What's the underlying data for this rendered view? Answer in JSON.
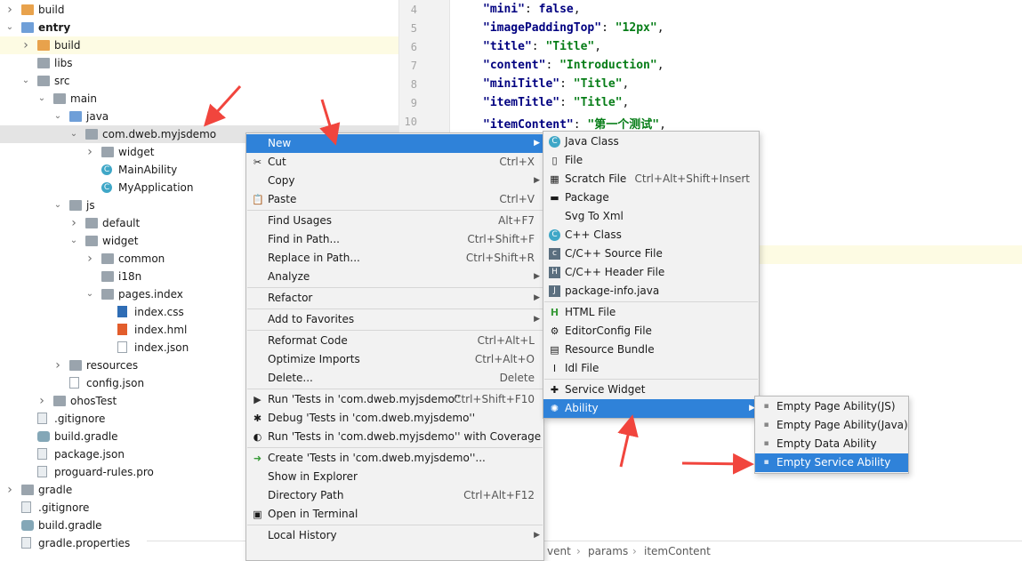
{
  "tree": [
    {
      "label": "build",
      "indent": 0,
      "arrow": ">",
      "icon": "folder-orange"
    },
    {
      "label": "entry",
      "indent": 0,
      "arrow": "v",
      "icon": "folder-blue",
      "bold": true
    },
    {
      "label": "build",
      "indent": 1,
      "arrow": ">",
      "icon": "folder-orange",
      "hl": true
    },
    {
      "label": "libs",
      "indent": 1,
      "arrow": "",
      "icon": "folder"
    },
    {
      "label": "src",
      "indent": 1,
      "arrow": "v",
      "icon": "folder"
    },
    {
      "label": "main",
      "indent": 2,
      "arrow": "v",
      "icon": "folder"
    },
    {
      "label": "java",
      "indent": 3,
      "arrow": "v",
      "icon": "folder-blue"
    },
    {
      "label": "com.dweb.myjsdemo",
      "indent": 4,
      "arrow": "v",
      "icon": "package",
      "selected": true
    },
    {
      "label": "widget",
      "indent": 5,
      "arrow": ">",
      "icon": "package"
    },
    {
      "label": "MainAbility",
      "indent": 5,
      "arrow": "",
      "icon": "class"
    },
    {
      "label": "MyApplication",
      "indent": 5,
      "arrow": "",
      "icon": "class"
    },
    {
      "label": "js",
      "indent": 3,
      "arrow": "v",
      "icon": "folder"
    },
    {
      "label": "default",
      "indent": 4,
      "arrow": ">",
      "icon": "folder"
    },
    {
      "label": "widget",
      "indent": 4,
      "arrow": "v",
      "icon": "folder"
    },
    {
      "label": "common",
      "indent": 5,
      "arrow": ">",
      "icon": "folder"
    },
    {
      "label": "i18n",
      "indent": 5,
      "arrow": "",
      "icon": "folder"
    },
    {
      "label": "pages.index",
      "indent": 5,
      "arrow": "v",
      "icon": "folder"
    },
    {
      "label": "index.css",
      "indent": 6,
      "arrow": "",
      "icon": "file-css"
    },
    {
      "label": "index.hml",
      "indent": 6,
      "arrow": "",
      "icon": "file-html"
    },
    {
      "label": "index.json",
      "indent": 6,
      "arrow": "",
      "icon": "file-json"
    },
    {
      "label": "resources",
      "indent": 3,
      "arrow": ">",
      "icon": "folder"
    },
    {
      "label": "config.json",
      "indent": 3,
      "arrow": "",
      "icon": "file-json"
    },
    {
      "label": "ohosTest",
      "indent": 2,
      "arrow": ">",
      "icon": "folder"
    },
    {
      "label": ".gitignore",
      "indent": 1,
      "arrow": "",
      "icon": "file"
    },
    {
      "label": "build.gradle",
      "indent": 1,
      "arrow": "",
      "icon": "gradle"
    },
    {
      "label": "package.json",
      "indent": 1,
      "arrow": "",
      "icon": "file"
    },
    {
      "label": "proguard-rules.pro",
      "indent": 1,
      "arrow": "",
      "icon": "file"
    },
    {
      "label": "gradle",
      "indent": 0,
      "arrow": ">",
      "icon": "folder"
    },
    {
      "label": ".gitignore",
      "indent": 0,
      "arrow": "",
      "icon": "file"
    },
    {
      "label": "build.gradle",
      "indent": 0,
      "arrow": "",
      "icon": "gradle"
    },
    {
      "label": "gradle.properties",
      "indent": 0,
      "arrow": "",
      "icon": "file"
    }
  ],
  "editor": {
    "lines": [
      {
        "n": "4",
        "key": "\"mini\"",
        "val": "false",
        "bool": true
      },
      {
        "n": "5",
        "key": "\"imagePaddingTop\"",
        "val": "\"12px\""
      },
      {
        "n": "6",
        "key": "\"title\"",
        "val": "\"Title\""
      },
      {
        "n": "7",
        "key": "\"content\"",
        "val": "\"Introduction\""
      },
      {
        "n": "8",
        "key": "\"miniTitle\"",
        "val": "\"Title\""
      },
      {
        "n": "9",
        "key": "\"itemTitle\"",
        "val": "\"Title\""
      },
      {
        "n": "10",
        "key": "\"itemContent\"",
        "val": "\"第一个测试\""
      }
    ],
    "breadcrumb": [
      "vent",
      "params",
      "itemContent"
    ]
  },
  "context_menu": [
    {
      "label": "New",
      "submenu": true,
      "active": true
    },
    {
      "label": "Cut",
      "shortcut": "Ctrl+X",
      "icon": "scissors-icon"
    },
    {
      "label": "Copy",
      "submenu": true
    },
    {
      "label": "Paste",
      "shortcut": "Ctrl+V",
      "icon": "clipboard-icon"
    },
    {
      "sep": true
    },
    {
      "label": "Find Usages",
      "shortcut": "Alt+F7"
    },
    {
      "label": "Find in Path...",
      "shortcut": "Ctrl+Shift+F"
    },
    {
      "label": "Replace in Path...",
      "shortcut": "Ctrl+Shift+R"
    },
    {
      "label": "Analyze",
      "submenu": true
    },
    {
      "sep": true
    },
    {
      "label": "Refactor",
      "submenu": true
    },
    {
      "sep": true
    },
    {
      "label": "Add to Favorites",
      "submenu": true
    },
    {
      "sep": true
    },
    {
      "label": "Reformat Code",
      "shortcut": "Ctrl+Alt+L"
    },
    {
      "label": "Optimize Imports",
      "shortcut": "Ctrl+Alt+O"
    },
    {
      "label": "Delete...",
      "shortcut": "Delete"
    },
    {
      "sep": true
    },
    {
      "label": "Run 'Tests in 'com.dweb.myjsdemo''",
      "shortcut": "Ctrl+Shift+F10",
      "icon": "run-icon"
    },
    {
      "label": "Debug 'Tests in 'com.dweb.myjsdemo''",
      "icon": "debug-icon"
    },
    {
      "label": "Run 'Tests in 'com.dweb.myjsdemo'' with Coverage",
      "icon": "coverage-icon"
    },
    {
      "sep": true
    },
    {
      "label": "Create 'Tests in 'com.dweb.myjsdemo''...",
      "icon": "create-test-icon"
    },
    {
      "label": "Show in Explorer"
    },
    {
      "label": "Directory Path",
      "shortcut": "Ctrl+Alt+F12"
    },
    {
      "label": "Open in Terminal",
      "icon": "terminal-icon"
    },
    {
      "sep": true
    },
    {
      "label": "Local History",
      "submenu": true
    }
  ],
  "new_menu": [
    {
      "label": "Java Class",
      "icon": "class-icon"
    },
    {
      "label": "File",
      "icon": "file-icon"
    },
    {
      "label": "Scratch File",
      "shortcut": "Ctrl+Alt+Shift+Insert",
      "icon": "scratch-icon"
    },
    {
      "label": "Package",
      "icon": "package-icon"
    },
    {
      "label": "Svg To Xml"
    },
    {
      "label": "C++ Class",
      "icon": "cpp-class-icon"
    },
    {
      "label": "C/C++ Source File",
      "icon": "cpp-source-icon"
    },
    {
      "label": "C/C++ Header File",
      "icon": "cpp-header-icon"
    },
    {
      "label": "package-info.java",
      "icon": "java-file-icon"
    },
    {
      "sep": true
    },
    {
      "label": "HTML File",
      "icon": "html-icon"
    },
    {
      "label": "EditorConfig File",
      "icon": "gear-icon"
    },
    {
      "label": "Resource Bundle",
      "icon": "bundle-icon"
    },
    {
      "label": "Idl File",
      "icon": "idl-icon"
    },
    {
      "sep": true
    },
    {
      "label": "Service Widget",
      "icon": "puzzle-icon"
    },
    {
      "label": "Ability",
      "submenu": true,
      "active": true,
      "icon": "ability-icon"
    }
  ],
  "ability_menu": [
    {
      "label": "Empty Page Ability(JS)"
    },
    {
      "label": "Empty Page Ability(Java)"
    },
    {
      "label": "Empty Data Ability"
    },
    {
      "label": "Empty Service Ability",
      "active": true
    }
  ],
  "colors": {
    "accent": "#2f82d9",
    "arrow": "#f1453d"
  }
}
